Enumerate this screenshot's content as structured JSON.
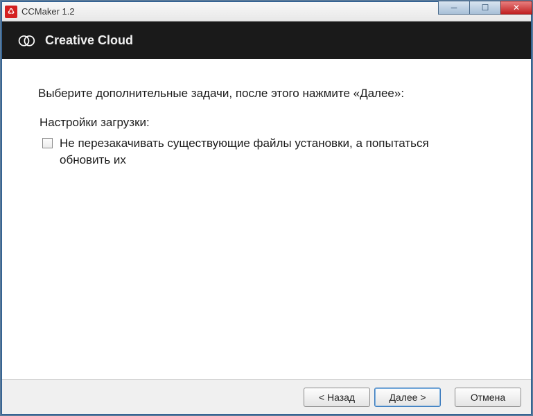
{
  "titlebar": {
    "title": "CCMaker 1.2",
    "icon_glyph": "♺"
  },
  "window_controls": {
    "minimize": "─",
    "maximize": "☐",
    "close": "✕"
  },
  "header": {
    "title": "Creative Cloud"
  },
  "content": {
    "instruction": "Выберите дополнительные задачи, после этого нажмите «Далее»:",
    "section_label": "Настройки загрузки:",
    "checkbox1_label": "Не перезакачивать существующие файлы установки, а попытаться обновить их",
    "checkbox1_checked": false
  },
  "buttons": {
    "back": "< Назад",
    "next": "Далее >",
    "cancel": "Отмена"
  }
}
